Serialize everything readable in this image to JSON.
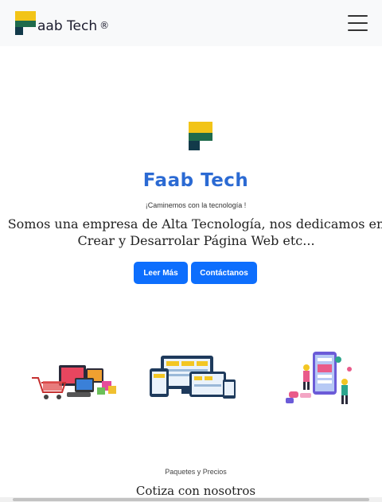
{
  "navbar": {
    "brand_text": "aab Tech",
    "brand_reg": "®",
    "menu_icon": "hamburger-menu-icon"
  },
  "hero": {
    "logo_icon": "faab-tech-logo-icon",
    "title": "Faab Tech",
    "subtitle": "¡Caminemos con la tecnología !",
    "description": "Somos una empresa de Alta Tecnología, nos dedicamos en Crear y Desarrolar Página Web etc...",
    "read_more_label": "Leer Más",
    "contact_label": "Contáctanos"
  },
  "illustrations": [
    "ecommerce-illustration",
    "responsive-devices-illustration",
    "mobile-app-illustration"
  ],
  "pricing": {
    "subtitle": "Paquetes y Precios",
    "title": "Cotiza con nosotros"
  },
  "colors": {
    "accent": "#0d6efd",
    "title_blue": "#2b6ad3",
    "logo_yellow": "#f2c417",
    "logo_green": "#1f6b4c",
    "logo_dark": "#123a4a"
  }
}
